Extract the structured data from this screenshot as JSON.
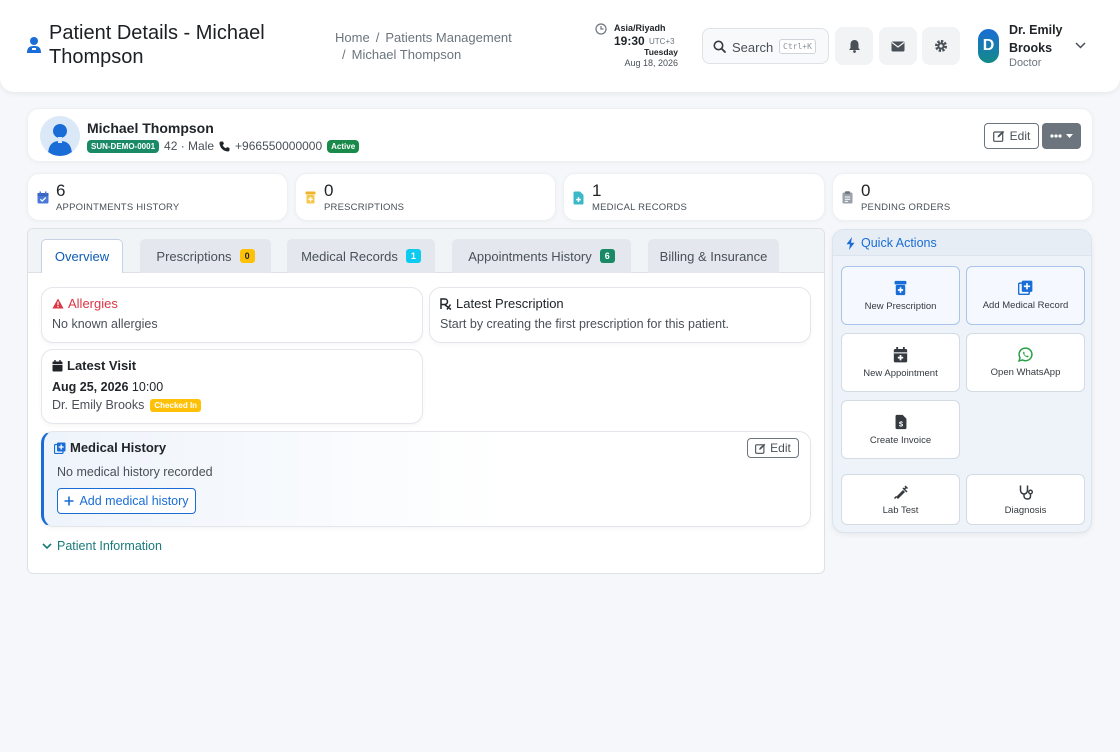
{
  "header": {
    "title": "Patient Details - Michael Thompson",
    "breadcrumb": [
      "Home",
      "Patients Management",
      "Michael Thompson"
    ],
    "clock": {
      "timezone": "Asia/Riyadh",
      "time": "19:30",
      "utc": "UTC+3",
      "weekday": "Tuesday",
      "date": "Aug 18, 2026"
    },
    "search": {
      "label": "Search",
      "shortcut": "Ctrl+K"
    },
    "user": {
      "initial": "D",
      "name": "Dr. Emily Brooks",
      "role": "Doctor"
    }
  },
  "patient": {
    "name": "Michael Thompson",
    "id": "SUN-DEMO-0001",
    "age_gender": "42 · Male",
    "phone": "+966550000000",
    "status": "Active",
    "edit_label": "Edit"
  },
  "stats": [
    {
      "value": "6",
      "label": "APPOINTMENTS HISTORY",
      "icon": "calendar-check-icon",
      "color": "#4a78d8"
    },
    {
      "value": "0",
      "label": "PRESCRIPTIONS",
      "icon": "prescription-bottle-icon",
      "color": "#f0b429"
    },
    {
      "value": "1",
      "label": "MEDICAL RECORDS",
      "icon": "file-medical-icon",
      "color": "#3bb9c9"
    },
    {
      "value": "0",
      "label": "PENDING ORDERS",
      "icon": "clipboard-icon",
      "color": "#9aa1a9"
    }
  ],
  "tabs": [
    {
      "label": "Overview",
      "badge": ""
    },
    {
      "label": "Prescriptions",
      "badge": "0"
    },
    {
      "label": "Medical Records",
      "badge": "1"
    },
    {
      "label": "Appointments History",
      "badge": "6"
    },
    {
      "label": "Billing & Insurance",
      "badge": ""
    }
  ],
  "overview": {
    "allergies": {
      "title": "Allergies",
      "text": "No known allergies"
    },
    "latest_prescription": {
      "title": "Latest Prescription",
      "text": "Start by creating the first prescription for this patient."
    },
    "latest_visit": {
      "title": "Latest Visit",
      "date": "Aug 25, 2026",
      "time": "10:00",
      "doctor": "Dr. Emily Brooks",
      "status": "Checked In"
    },
    "medical_history": {
      "title": "Medical History",
      "edit_label": "Edit",
      "text": "No medical history recorded",
      "add_label": "Add medical history"
    },
    "patient_info_label": "Patient Information"
  },
  "quick_actions": {
    "title": "Quick Actions",
    "items": [
      {
        "label": "New Prescription",
        "icon": "prescription-bottle-icon"
      },
      {
        "label": "Add Medical Record",
        "icon": "add-record-icon"
      },
      {
        "label": "New Appointment",
        "icon": "calendar-plus-icon"
      },
      {
        "label": "Open WhatsApp",
        "icon": "whatsapp-icon"
      },
      {
        "label": "Create Invoice",
        "icon": "invoice-icon"
      },
      {
        "label": "Lab Test",
        "icon": "syringe-icon"
      },
      {
        "label": "Diagnosis",
        "icon": "stethoscope-icon"
      }
    ]
  },
  "colors": {
    "primary": "#1a6dd6",
    "success": "#1a8a4a",
    "danger": "#dc3545",
    "warning": "#ffc107",
    "info": "#0dcaf0",
    "teal": "#1a7a7a"
  }
}
